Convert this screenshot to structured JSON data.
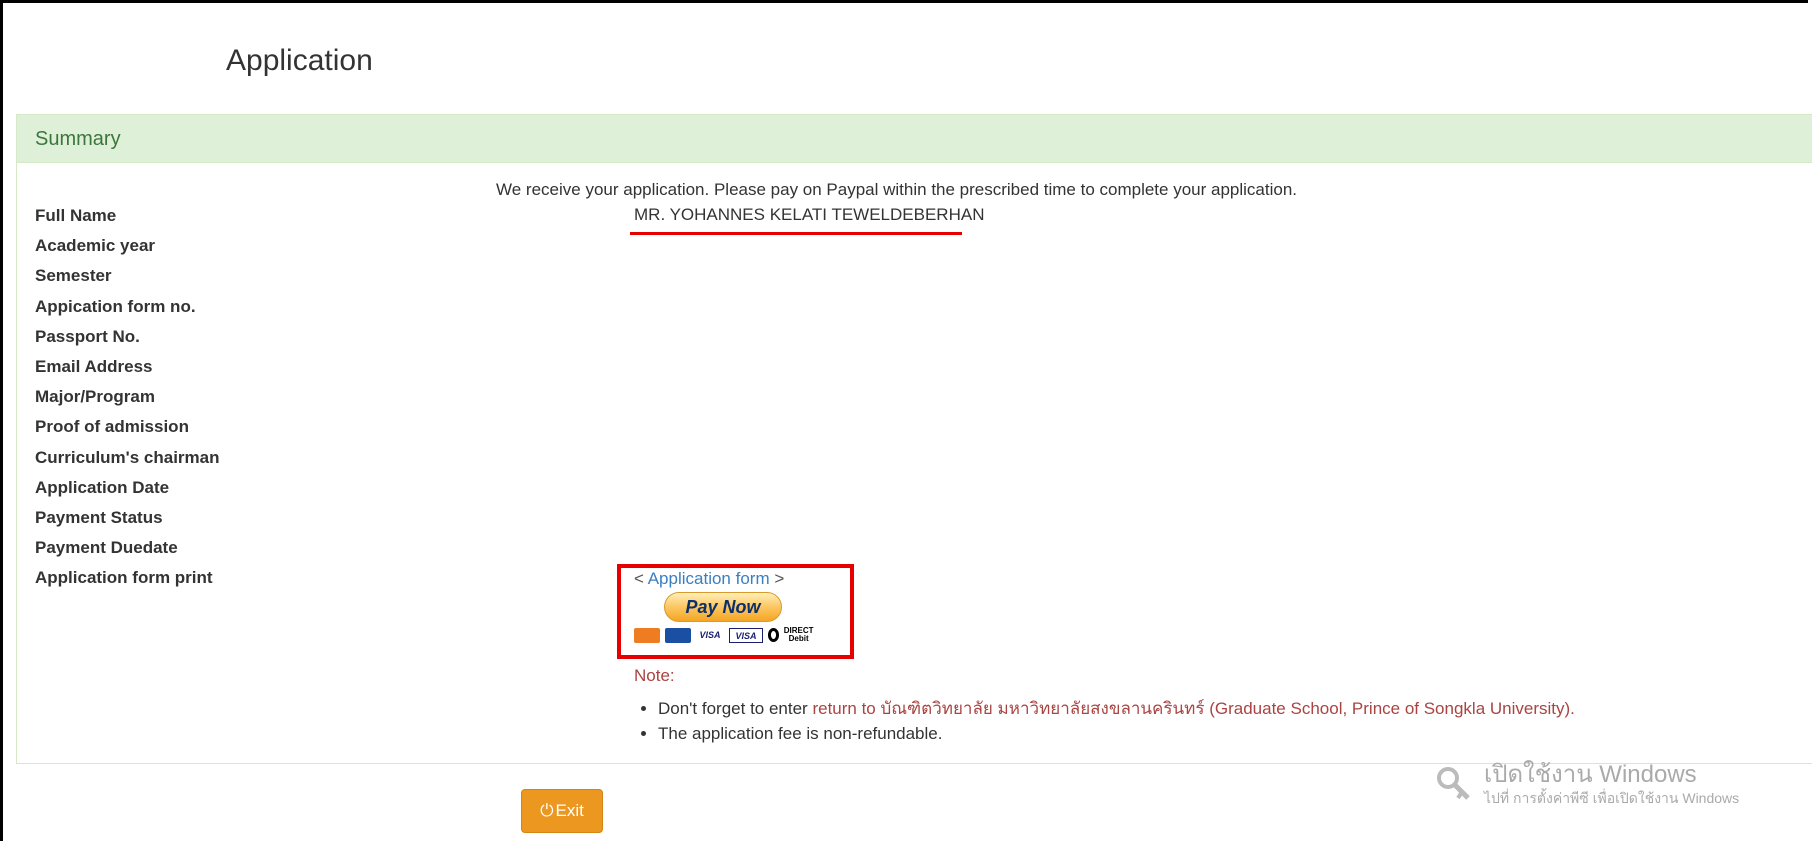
{
  "page": {
    "title": "Application"
  },
  "panel": {
    "heading": "Summary"
  },
  "notice": "We receive your application. Please pay on Paypal within the prescribed time to complete your application.",
  "fields": [
    {
      "label": "Full Name",
      "value": "MR. YOHANNES KELATI TEWELDEBERHAN"
    },
    {
      "label": "Academic year",
      "value": ""
    },
    {
      "label": "Semester",
      "value": ""
    },
    {
      "label": "Appication form no.",
      "value": ""
    },
    {
      "label": "Passport No.",
      "value": ""
    },
    {
      "label": "Email Address",
      "value": ""
    },
    {
      "label": "Major/Program",
      "value": ""
    },
    {
      "label": "Proof of admission",
      "value": ""
    },
    {
      "label": "Curriculum's chairman",
      "value": ""
    },
    {
      "label": "Application Date",
      "value": ""
    },
    {
      "label": "Payment Status",
      "value": ""
    },
    {
      "label": "Payment Duedate",
      "value": ""
    },
    {
      "label": "Application form print",
      "value": ""
    }
  ],
  "application_form_link": {
    "prefix": "< ",
    "label": "Application form",
    "suffix": " >"
  },
  "paypal": {
    "button_label": "Pay Now",
    "cards": [
      "MasterCard",
      "Maestro",
      "VISA",
      "VISA Electron",
      "DIRECT Debit"
    ],
    "direct_debit_label": "DIRECT Debit"
  },
  "note": {
    "title": "Note:",
    "item1_prefix": "Don't forget to enter ",
    "item1_highlight": "return to บัณฑิตวิทยาลัย มหาวิทยาลัยสงขลานครินทร์ (Graduate School, Prince of Songkla University).",
    "item2": "The application fee is non-refundable."
  },
  "exit_button": {
    "label": "Exit"
  },
  "watermark": {
    "title": "เปิดใช้งาน Windows",
    "subtitle": "ไปที่ การตั้งค่าพีซี เพื่อเปิดใช้งาน Windows"
  },
  "colors": {
    "panel_heading_bg": "#dff0d8",
    "panel_heading_text": "#3c763d",
    "highlight_red": "#e60000",
    "exit_button": "#ec971f",
    "link": "#3a7fc1",
    "note_red": "#a94442"
  }
}
